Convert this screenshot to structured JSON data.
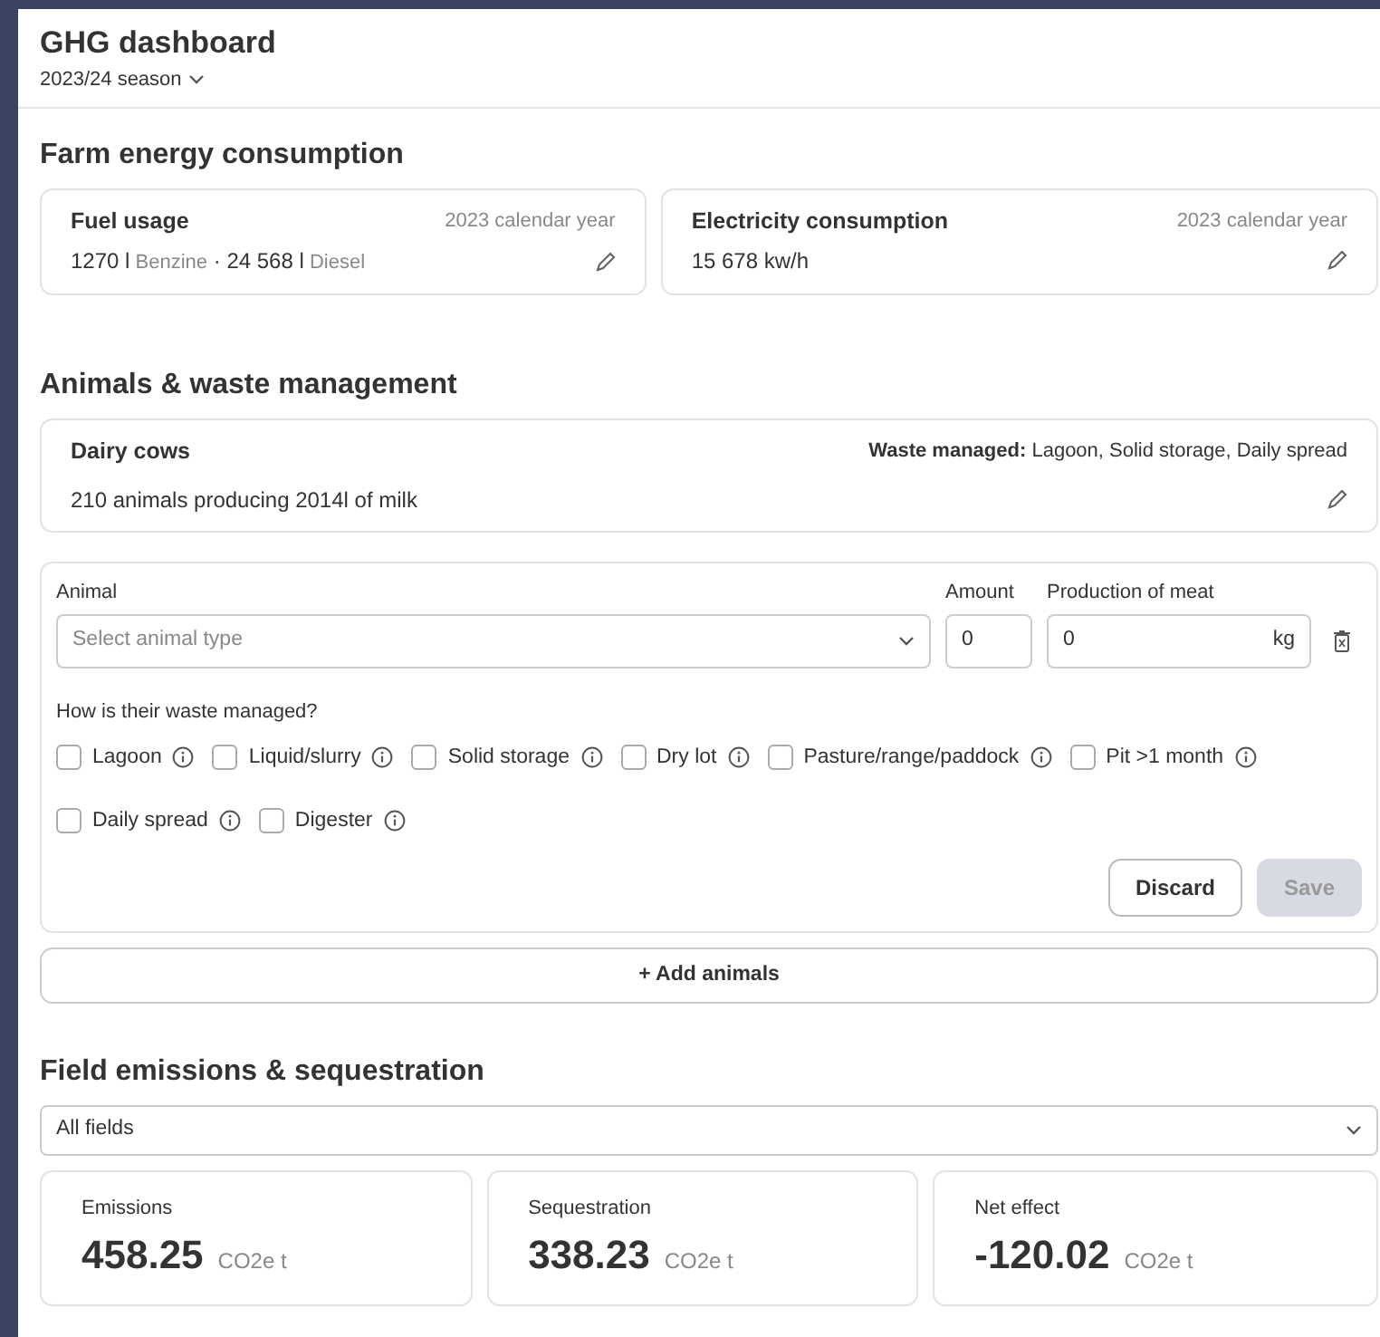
{
  "header": {
    "title": "GHG dashboard",
    "season": "2023/24 season"
  },
  "energy": {
    "heading": "Farm energy consumption",
    "separator": "·",
    "cards": [
      {
        "title": "Fuel usage",
        "period": "2023 calendar year",
        "readings": [
          {
            "amount": "1270 l",
            "fuel": "Benzine"
          },
          {
            "amount": "24 568 l",
            "fuel": "Diesel"
          }
        ]
      },
      {
        "title": "Electricity consumption",
        "period": "2023 calendar year",
        "readings": [
          {
            "amount": "15 678 kw/h"
          }
        ]
      }
    ]
  },
  "animals": {
    "heading": "Animals & waste management",
    "herds": [
      {
        "name": "Dairy cows",
        "waste": "**Waste managed:** Lagoon, Solid storage, Daily spread",
        "summary": "210 animals producing 2014l of milk"
      }
    ],
    "form": {
      "animal_label": "Animal",
      "animal_placeholder": "Select animal type",
      "amount_label": "Amount",
      "amount_value": "0",
      "production_label": "Production of meat",
      "production_value": "0",
      "production_unit": "kg",
      "waste_question": "How is their waste managed?",
      "options": [
        {
          "label": "Lagoon",
          "checked": false
        },
        {
          "label": "Liquid/slurry",
          "checked": false
        },
        {
          "label": "Solid storage",
          "checked": false
        },
        {
          "label": "Dry lot",
          "checked": false
        },
        {
          "label": "Pasture/range/paddock",
          "checked": false
        },
        {
          "label": "Pit >1 month",
          "checked": false
        },
        {
          "label": "Daily spread",
          "checked": false
        },
        {
          "label": "Digester",
          "checked": false
        }
      ],
      "discard": {
        "label": "Discard",
        "disabled": false
      },
      "save": {
        "label": "Save",
        "disabled": true
      }
    },
    "add_button": "+ Add animals"
  },
  "fields": {
    "heading": "Field emissions & sequestration",
    "filter": "All fields",
    "metrics": [
      {
        "label": "Emissions",
        "value": "458.25",
        "unit": "CO2e t"
      },
      {
        "label": "Sequestration",
        "value": "338.23",
        "unit": "CO2e t"
      },
      {
        "label": "Net effect",
        "value": "-120.02",
        "unit": "CO2e t"
      }
    ]
  }
}
